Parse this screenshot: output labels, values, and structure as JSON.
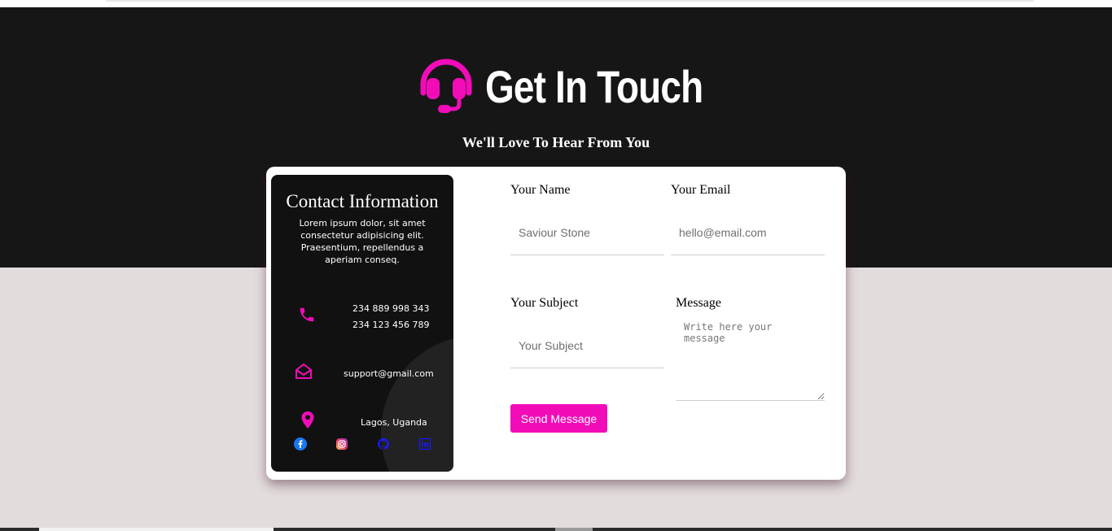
{
  "header": {
    "title": "Get In Touch",
    "subtitle": "We'll Love To Hear From You",
    "icon": "headset-icon"
  },
  "contact_info": {
    "title": "Contact Information",
    "description": "Lorem ipsum dolor, sit amet consectetur adipisicing elit. Praesentium, repellendus a aperiam conseq.",
    "phones": [
      "234 889 998 343",
      "234 123 456 789"
    ],
    "email": "support@gmail.com",
    "location": "Lagos, Uganda",
    "socials": [
      "facebook-icon",
      "instagram-icon",
      "github-icon",
      "linkedin-icon"
    ]
  },
  "form": {
    "name_label": "Your Name",
    "name_placeholder": "Saviour Stone",
    "email_label": "Your Email",
    "email_placeholder": "hello@email.com",
    "subject_label": "Your Subject",
    "subject_placeholder": "Your Subject",
    "message_label": "Message",
    "message_placeholder": "Write here your message",
    "submit_label": "Send Message"
  },
  "colors": {
    "accent": "#f20cb8",
    "hero_background": "#171617",
    "page_background": "#e3dcdc"
  }
}
